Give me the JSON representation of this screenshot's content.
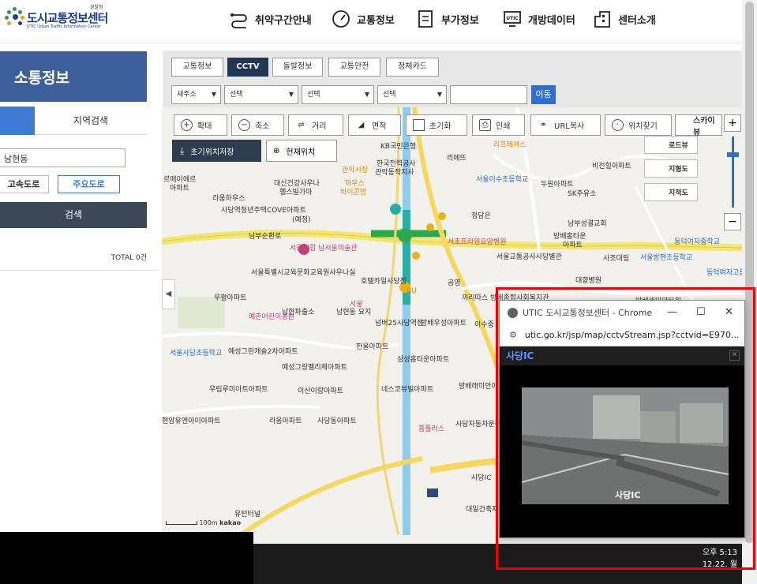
{
  "header": {
    "logo": {
      "sub": "경찰청",
      "main": "도시교통정보센터",
      "eng": "UTIC  Urban Traffic Information Center",
      "color": "#1a3e8c"
    },
    "nav": [
      {
        "label": "취약구간안내",
        "icon": "route-icon"
      },
      {
        "label": "교통정보",
        "icon": "speedometer-icon"
      },
      {
        "label": "부가정보",
        "icon": "document-icon"
      },
      {
        "label": "개방데이터",
        "icon": "monitor-icon"
      },
      {
        "label": "센터소개",
        "icon": "building-icon"
      }
    ]
  },
  "left_panel": {
    "title": "소통정보",
    "tab_label": "지역검색",
    "search_value": "남현동",
    "road_buttons": [
      "고속도로",
      "주요도로"
    ],
    "search_button": "검색",
    "total": "TOTAL 0건",
    "accent": "#3d5f9a"
  },
  "menu": {
    "tabs": [
      {
        "label": "교통정보",
        "active": false
      },
      {
        "label": "CCTV",
        "active": true
      },
      {
        "label": "돌발정보",
        "active": false
      },
      {
        "label": "교통안전",
        "active": false
      },
      {
        "label": "정체카드",
        "active": false
      }
    ],
    "selects": [
      "새주소",
      "선택",
      "선택",
      "선택"
    ],
    "go_button": "이동"
  },
  "map": {
    "tools": [
      {
        "label": "확대",
        "icon": "zoom-in-icon"
      },
      {
        "label": "축소",
        "icon": "zoom-out-icon"
      },
      {
        "label": "거리",
        "icon": "distance-icon"
      },
      {
        "label": "면적",
        "icon": "area-icon"
      },
      {
        "label": "초기화",
        "icon": "reset-icon"
      },
      {
        "label": "인쇄",
        "icon": "print-icon"
      },
      {
        "label": "URL복사",
        "icon": "link-icon"
      },
      {
        "label": "위치찾기",
        "icon": "locate-icon"
      }
    ],
    "save_init": "초기위치저장",
    "current_pos": "현재위치",
    "skyview": "스카이뷰",
    "side_buttons": [
      "로드뷰",
      "지형도",
      "지적도"
    ],
    "scale_label": "100m",
    "provider": "kakao",
    "labels": [
      "리프레셔스",
      "KB국민은행",
      "리에뜨",
      "관악시장",
      "한국전력공사",
      "관악동작지사",
      "르메이에르",
      "아파트",
      "대신건강사우나",
      "헬스빌가마",
      "하우스",
      "바이콘빈",
      "라움하우스",
      "사당역청년주택COVE아파트",
      "(예정)",
      "서울이수초등학교",
      "두원아파트",
      "SK주유소",
      "비전힐아파트",
      "정담은",
      "남부성결교회",
      "방배홈타운",
      "아파트",
      "서초프라임요양병원",
      "서울교통공사사당별관",
      "사조대림",
      "동덕여자중학교",
      "서울방현초등학교",
      "동덕여자고등학교",
      "대향병원",
      "남부순환로",
      "서울시립 남서울미술관",
      "서울특별시교육문화교육원사우나실",
      "호텔카일사당점",
      "공영",
      "우평아파트",
      "예촌어린이공원",
      "남현파출소",
      "남현동 요지",
      "서울",
      "넘버25사당역점",
      "방배우성아파트",
      "까리따스 방배종합사회복지관",
      "이수중",
      "서울사당초등학교",
      "예성그린캐슬2차아파트",
      "예성그랑펠리체아파트",
      "한울아파트",
      "삼성홈타운아파트",
      "방배래미안아파트",
      "우림루미아트아파트",
      "이산이랑아파트",
      "네스코뷰빌아파트",
      "라움아파트",
      "사당동아파트",
      "홈플러스",
      "사당자동차운전전문학원",
      "사당IC",
      "대일건축자재백화점",
      "현암유엔아이아파트",
      "방배래미안타워",
      "유턴터널",
      "공영",
      "CU"
    ]
  },
  "popup": {
    "window_title": "UTIC 도시교통정보센터 - Chrome",
    "url": "utic.go.kr/jsp/map/cctvStream.jsp?cctvid=E970...",
    "header": "사당IC",
    "video_label": "사당IC"
  },
  "taskbar": {
    "time": "오후 5:13",
    "date": "12.22. 월"
  }
}
